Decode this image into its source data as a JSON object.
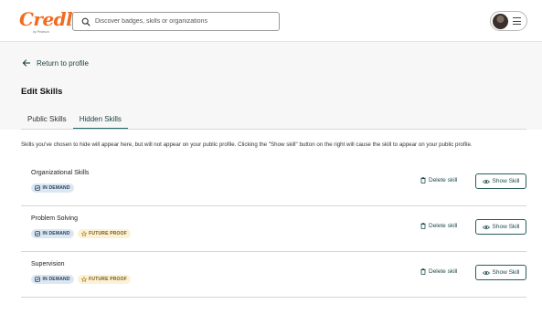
{
  "header": {
    "logo_text": "Credly",
    "logo_sub": "by Pearson",
    "search_placeholder": "Discover badges, skills or organizations",
    "search_value": "",
    "icons": {
      "search": "search-icon",
      "avatar": "user-avatar",
      "menu": "hamburger-icon"
    }
  },
  "nav": {
    "back_label": "Return to profile",
    "back_icon": "arrow-left-icon"
  },
  "page": {
    "title": "Edit Skills",
    "tabs": [
      {
        "label": "Public Skills",
        "active": false
      },
      {
        "label": "Hidden Skills",
        "active": true
      }
    ],
    "description": "Skills you've chosen to hide will appear here, but will not appear on your public profile. Clicking the \"Show skill\" button on the right will cause the skill to appear on your public profile."
  },
  "skills": [
    {
      "name": "Organizational Skills",
      "badges": [
        {
          "label": "IN DEMAND",
          "kind": "demand"
        }
      ]
    },
    {
      "name": "Problem Solving",
      "badges": [
        {
          "label": "IN DEMAND",
          "kind": "demand"
        },
        {
          "label": "FUTURE PROOF",
          "kind": "future"
        }
      ]
    },
    {
      "name": "Supervision",
      "badges": [
        {
          "label": "IN DEMAND",
          "kind": "demand"
        },
        {
          "label": "FUTURE PROOF",
          "kind": "future"
        }
      ]
    }
  ],
  "actions": {
    "delete_label": "Delete skill",
    "show_label": "Show Skill"
  },
  "colors": {
    "brand": "#f26b21",
    "accent": "#236a6a",
    "demand_bg": "#dde7f2",
    "future_bg": "#fbf1d6"
  }
}
